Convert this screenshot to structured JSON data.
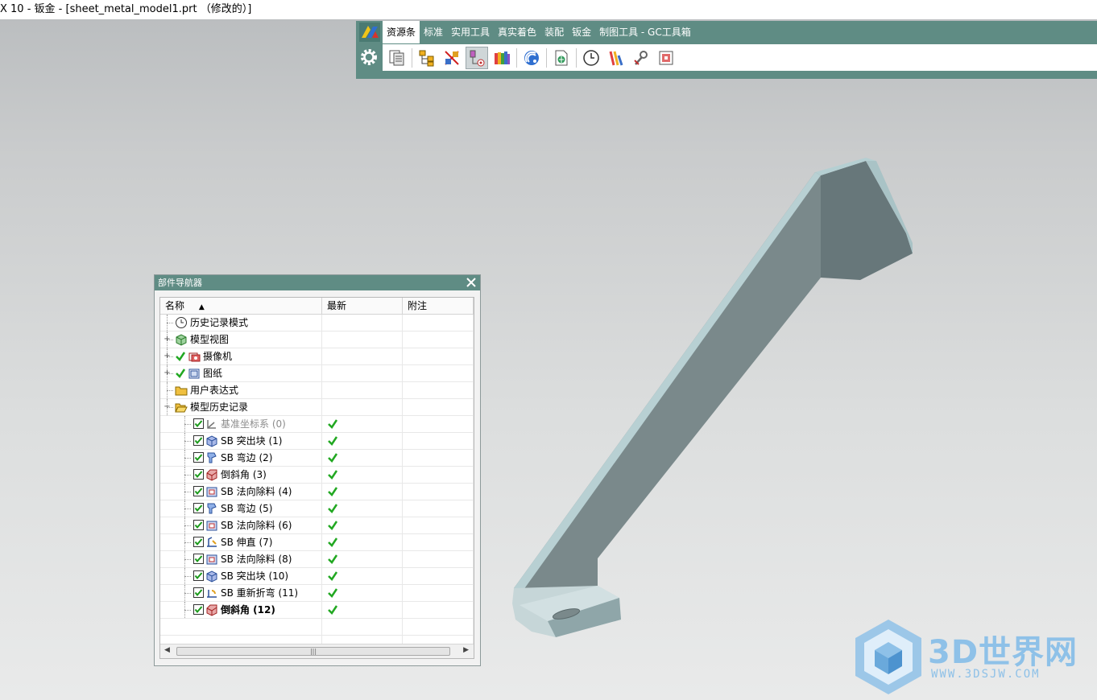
{
  "window": {
    "title": "X 10 - 钣金 - [sheet_metal_model1.prt （修改的）]"
  },
  "resource_bar": {
    "tabs": [
      "资源条",
      "标准",
      "实用工具",
      "真实着色",
      "装配",
      "钣金",
      "制图工具 - GC工具箱"
    ],
    "active_tab": "资源条",
    "icons": [
      "part-navigator-icon",
      "assembly-navigator-icon",
      "constraint-navigator-icon",
      "part-navigator-selected-icon",
      "reuse-library-icon",
      "hd3d-tools-icon",
      "web-browser-icon",
      "history-icon",
      "system-materials-icon",
      "process-studio-icon",
      "roles-icon"
    ]
  },
  "part_navigator": {
    "title": "部件导航器",
    "columns": {
      "name": "名称",
      "latest": "最新",
      "comment": "附注"
    },
    "rows": [
      {
        "label": "历史记录模式",
        "icon": "clock-icon",
        "level": 0,
        "expander": "",
        "checked": false,
        "style": "normal",
        "latest": false
      },
      {
        "label": "模型视图",
        "icon": "model-view-icon",
        "level": 0,
        "expander": "+",
        "checked": false,
        "style": "normal",
        "latest": false
      },
      {
        "label": "摄像机",
        "icon": "camera-icon",
        "level": 0,
        "expander": "+",
        "checked": true,
        "style": "normal",
        "latest": false
      },
      {
        "label": "图纸",
        "icon": "drawing-icon",
        "level": 0,
        "expander": "+",
        "checked": true,
        "style": "normal",
        "latest": false
      },
      {
        "label": "用户表达式",
        "icon": "folder-icon",
        "level": 0,
        "expander": "",
        "checked": false,
        "style": "normal",
        "latest": false
      },
      {
        "label": "模型历史记录",
        "icon": "folder-open-icon",
        "level": 0,
        "expander": "−",
        "checked": false,
        "style": "normal",
        "latest": false
      },
      {
        "label": "基准坐标系 (0)",
        "icon": "datum-csys-icon",
        "level": 1,
        "expander": "",
        "checked": true,
        "style": "grey",
        "latest": true
      },
      {
        "label": "SB 突出块 (1)",
        "icon": "tab-block-icon",
        "level": 1,
        "expander": "",
        "checked": true,
        "style": "normal",
        "latest": true
      },
      {
        "label": "SB 弯边 (2)",
        "icon": "flange-icon",
        "level": 1,
        "expander": "",
        "checked": true,
        "style": "normal",
        "latest": true
      },
      {
        "label": "倒斜角 (3)",
        "icon": "chamfer-icon",
        "level": 1,
        "expander": "",
        "checked": true,
        "style": "normal",
        "latest": true
      },
      {
        "label": "SB 法向除料 (4)",
        "icon": "normal-cutout-icon",
        "level": 1,
        "expander": "",
        "checked": true,
        "style": "normal",
        "latest": true
      },
      {
        "label": "SB 弯边 (5)",
        "icon": "flange-icon",
        "level": 1,
        "expander": "",
        "checked": true,
        "style": "normal",
        "latest": true
      },
      {
        "label": "SB 法向除料 (6)",
        "icon": "normal-cutout-icon",
        "level": 1,
        "expander": "",
        "checked": true,
        "style": "normal",
        "latest": true
      },
      {
        "label": "SB 伸直 (7)",
        "icon": "unbend-icon",
        "level": 1,
        "expander": "",
        "checked": true,
        "style": "normal",
        "latest": true
      },
      {
        "label": "SB 法向除料 (8)",
        "icon": "normal-cutout-icon",
        "level": 1,
        "expander": "",
        "checked": true,
        "style": "normal",
        "latest": true
      },
      {
        "label": "SB 突出块 (10)",
        "icon": "tab-block-icon",
        "level": 1,
        "expander": "",
        "checked": true,
        "style": "normal",
        "latest": true
      },
      {
        "label": "SB 重新折弯 (11)",
        "icon": "rebend-icon",
        "level": 1,
        "expander": "",
        "checked": true,
        "style": "normal",
        "latest": true
      },
      {
        "label": "倒斜角 (12)",
        "icon": "chamfer-icon",
        "level": 1,
        "expander": "",
        "checked": true,
        "style": "bold",
        "latest": true
      }
    ]
  },
  "watermark": {
    "text": "3D世界网",
    "sub": "WWW.3DSJW.COM"
  },
  "colors": {
    "bar": "#5f8c84",
    "check_green": "#22a822",
    "model_face": "#7a898b",
    "model_edge": "#a9c3c6"
  }
}
